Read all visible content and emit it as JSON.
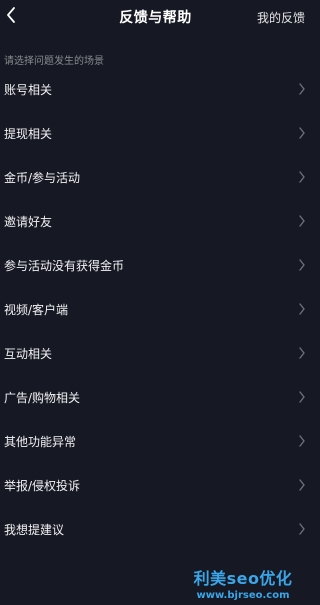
{
  "header": {
    "title": "反馈与帮助",
    "right_link": "我的反馈",
    "back_icon": "chevron-left-icon"
  },
  "section_label": "请选择问题发生的场景",
  "items": [
    {
      "label": "账号相关"
    },
    {
      "label": "提现相关"
    },
    {
      "label": "金币/参与活动"
    },
    {
      "label": "邀请好友"
    },
    {
      "label": "参与活动没有获得金币"
    },
    {
      "label": "视频/客户端"
    },
    {
      "label": "互动相关"
    },
    {
      "label": "广告/购物相关"
    },
    {
      "label": "其他功能异常"
    },
    {
      "label": "举报/侵权投诉"
    },
    {
      "label": "我想提建议"
    }
  ],
  "watermark": {
    "title": "利美seo优化",
    "url": "www.bjrseo.com"
  },
  "colors": {
    "background": "#161823",
    "text": "#ffffff",
    "muted": "#8a8b91",
    "chevron": "#6e6f76",
    "watermark": "#3aa6e8"
  }
}
